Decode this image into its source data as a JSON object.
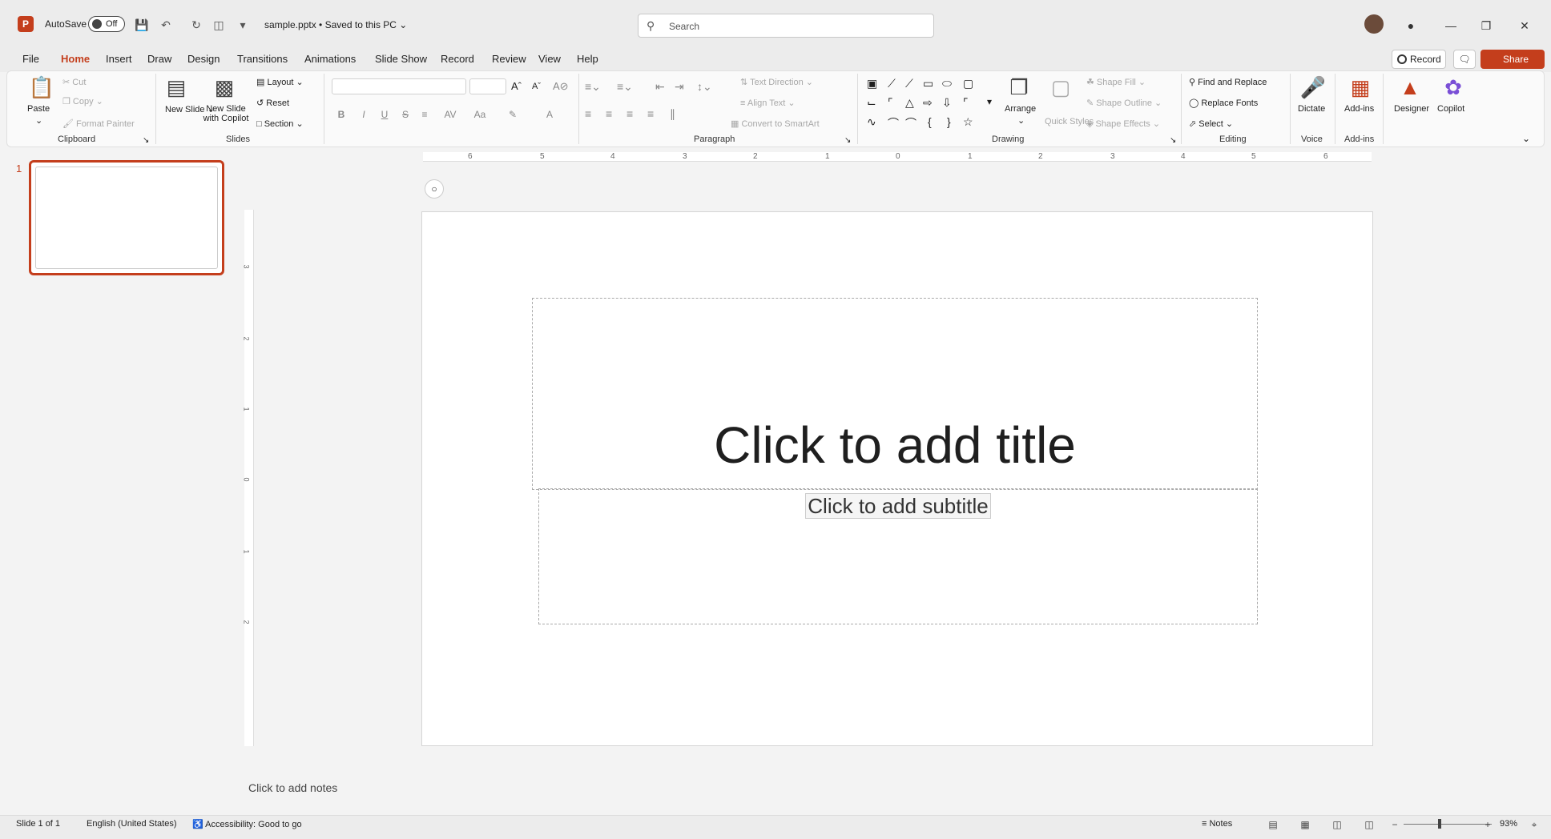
{
  "titlebar": {
    "autosave_label": "AutoSave",
    "autosave_state": "Off",
    "filename": "sample.pptx • Saved to this PC",
    "search_placeholder": "Search"
  },
  "menu": {
    "tabs": [
      "File",
      "Home",
      "Insert",
      "Draw",
      "Design",
      "Transitions",
      "Animations",
      "Slide Show",
      "Record",
      "Review",
      "View",
      "Help"
    ],
    "active": "Home",
    "record_btn": "Record",
    "share_btn": "Share"
  },
  "ribbon": {
    "clipboard": {
      "paste": "Paste",
      "cut": "Cut",
      "copy": "Copy",
      "format_painter": "Format Painter",
      "group": "Clipboard"
    },
    "slides": {
      "new_slide": "New Slide",
      "new_slide_copilot": "New Slide with Copilot",
      "layout": "Layout",
      "reset": "Reset",
      "section": "Section",
      "group": "Slides"
    },
    "font": {
      "bold": "B",
      "italic": "I",
      "underline": "U",
      "strike": "S"
    },
    "paragraph": {
      "text_direction": "Text Direction",
      "align_text": "Align Text",
      "convert_smartart": "Convert to SmartArt",
      "group": "Paragraph"
    },
    "drawing": {
      "arrange": "Arrange",
      "quick_styles": "Quick Styles",
      "shape_fill": "Shape Fill",
      "shape_outline": "Shape Outline",
      "shape_effects": "Shape Effects",
      "group": "Drawing"
    },
    "editing": {
      "find_replace": "Find and Replace",
      "replace_fonts": "Replace Fonts",
      "select": "Select",
      "group": "Editing"
    },
    "voice": {
      "dictate": "Dictate",
      "group": "Voice"
    },
    "addins": {
      "addins": "Add-ins",
      "group": "Add-ins"
    },
    "designer": "Designer",
    "copilot": "Copilot"
  },
  "ruler": {
    "h_numbers": [
      "6",
      "5",
      "4",
      "3",
      "2",
      "1",
      "0",
      "1",
      "2",
      "3",
      "4",
      "5",
      "6"
    ],
    "v_numbers": [
      "3",
      "2",
      "1",
      "0",
      "1",
      "2"
    ]
  },
  "slide_pane": {
    "slide_number": "1"
  },
  "slide": {
    "title_placeholder": "Click to add title",
    "subtitle_placeholder": "Click to add subtitle"
  },
  "notes_placeholder": "Click to add notes",
  "status": {
    "slide_info": "Slide 1 of 1",
    "language": "English (United States)",
    "accessibility": "Accessibility: Good to go",
    "notes": "Notes",
    "zoom": "93%"
  },
  "colors": {
    "accent": "#c43e1c"
  }
}
